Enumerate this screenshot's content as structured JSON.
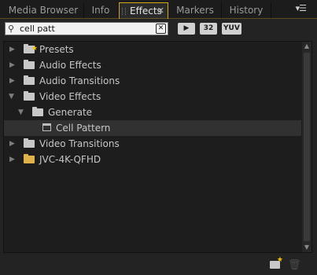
{
  "tabs": [
    {
      "label": "Media Browser"
    },
    {
      "label": "Info"
    },
    {
      "label": "Effects"
    },
    {
      "label": "Markers"
    },
    {
      "label": "History"
    }
  ],
  "active_tab": "Effects",
  "search": {
    "value": "cell patt"
  },
  "filter_buttons": {
    "accelerated": "",
    "bit32": "32",
    "yuv": "YUV"
  },
  "tree": {
    "items": [
      {
        "label": "Presets",
        "level": 0,
        "expanded": false,
        "icon": "presets-folder-icon"
      },
      {
        "label": "Audio Effects",
        "level": 0,
        "expanded": false,
        "icon": "folder-icon"
      },
      {
        "label": "Audio Transitions",
        "level": 0,
        "expanded": false,
        "icon": "folder-icon"
      },
      {
        "label": "Video Effects",
        "level": 0,
        "expanded": true,
        "icon": "folder-icon"
      },
      {
        "label": "Generate",
        "level": 1,
        "expanded": true,
        "icon": "folder-icon"
      },
      {
        "label": "Cell Pattern",
        "level": 2,
        "selected": true,
        "icon": "effect-icon"
      },
      {
        "label": "Video Transitions",
        "level": 0,
        "expanded": false,
        "icon": "folder-icon"
      },
      {
        "label": "JVC-4K-QFHD",
        "level": 0,
        "expanded": false,
        "icon": "custom-bin-folder-icon"
      }
    ]
  },
  "colors": {
    "accent": "#d6a91a",
    "panel": "#232323",
    "tree_bg": "#1d1d1d"
  }
}
